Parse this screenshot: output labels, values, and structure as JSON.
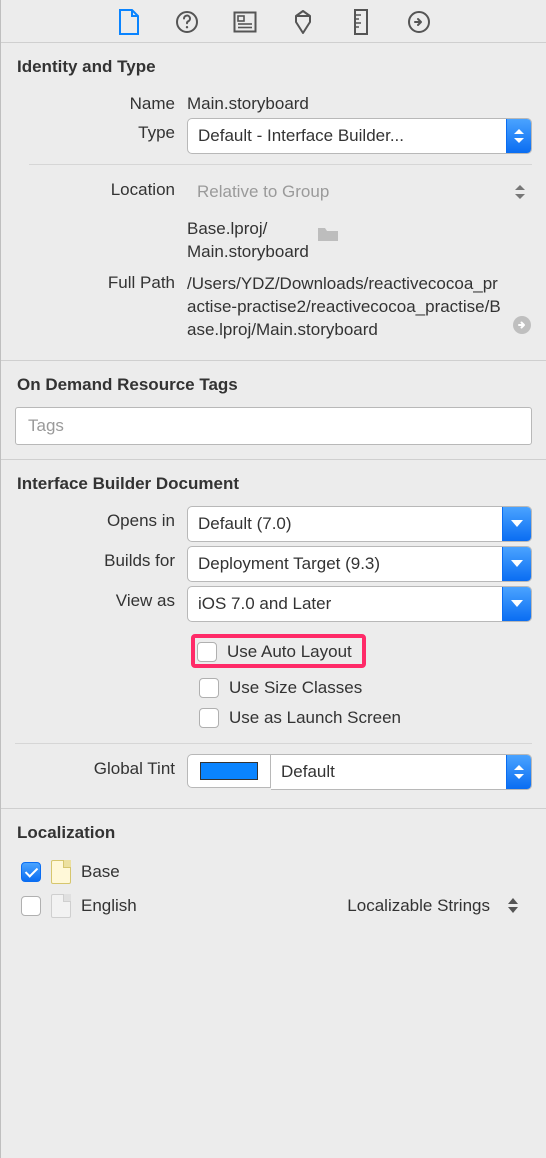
{
  "sections": {
    "identity": {
      "title": "Identity and Type",
      "name_label": "Name",
      "name_value": "Main.storyboard",
      "type_label": "Type",
      "type_value": "Default - Interface Builder...",
      "location_label": "Location",
      "location_value": "Relative to Group",
      "location_path": "Base.lproj/\nMain.storyboard",
      "fullpath_label": "Full Path",
      "fullpath_value": "/Users/YDZ/Downloads/reactivecocoa_practise-practise2/reactivecocoa_practise/Base.lproj/Main.storyboard"
    },
    "ondemand": {
      "title": "On Demand Resource Tags",
      "placeholder": "Tags"
    },
    "ibdoc": {
      "title": "Interface Builder Document",
      "opens_label": "Opens in",
      "opens_value": "Default (7.0)",
      "builds_label": "Builds for",
      "builds_value": "Deployment Target (9.3)",
      "view_label": "View as",
      "view_value": "iOS 7.0 and Later",
      "autolayout": "Use Auto Layout",
      "sizeclasses": "Use Size Classes",
      "launchscreen": "Use as Launch Screen",
      "tint_label": "Global Tint",
      "tint_value": "Default",
      "tint_color": "#0a84ff"
    },
    "loc": {
      "title": "Localization",
      "base": "Base",
      "english": "English",
      "english_type": "Localizable Strings"
    }
  }
}
